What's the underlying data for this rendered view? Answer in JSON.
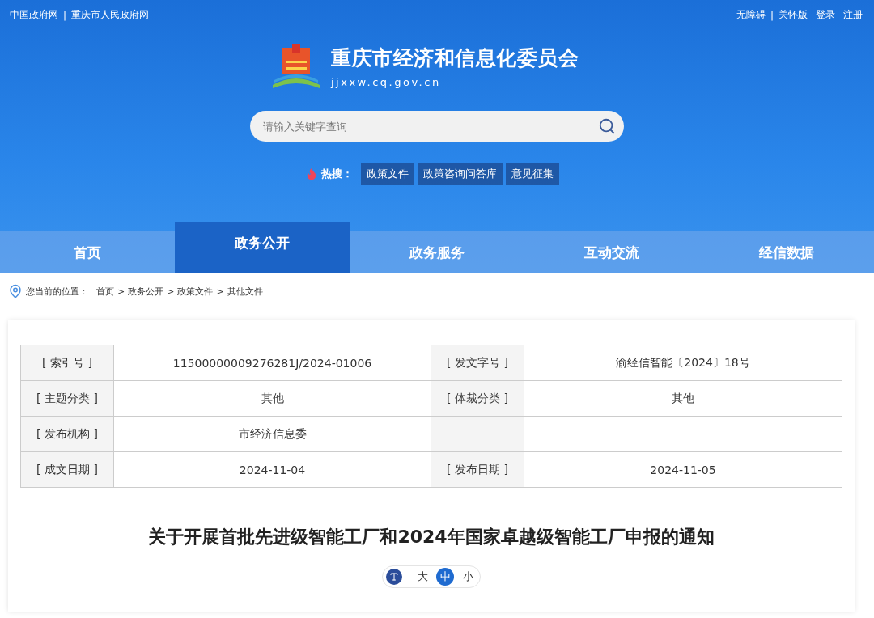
{
  "top_bar": {
    "left_links": [
      "中国政府网",
      "重庆市人民政府网"
    ],
    "left_separator": "|",
    "right_links": [
      "无障碍",
      "关怀版",
      "登录",
      "注册"
    ],
    "right_separator": "|"
  },
  "site": {
    "name": "重庆市经济和信息化委员会",
    "domain": "jjxxw.cq.gov.cn"
  },
  "search": {
    "placeholder": "请输入关键字查询"
  },
  "hot_search": {
    "label": "热搜：",
    "tags": [
      "政策文件",
      "政策咨询问答库",
      "意见征集"
    ]
  },
  "nav": [
    {
      "label": "首页",
      "selected": false
    },
    {
      "label": "政务公开",
      "selected": true
    },
    {
      "label": "政务服务",
      "selected": false
    },
    {
      "label": "互动交流",
      "selected": false
    },
    {
      "label": "经信数据",
      "selected": false
    }
  ],
  "breadcrumb": {
    "label": "您当前的位置：",
    "items": [
      "首页",
      "政务公开",
      "政策文件",
      "其他文件"
    ],
    "separator": ">"
  },
  "info_table": [
    {
      "label_1": "[ 索引号 ]",
      "value_1": "11500000009276281J/2024-01006",
      "label_2": "[ 发文字号 ]",
      "value_2": "渝经信智能〔2024〕18号"
    },
    {
      "label_1": "[ 主题分类 ]",
      "value_1": "其他",
      "label_2": "[ 体裁分类 ]",
      "value_2": "其他"
    },
    {
      "label_1": "[ 发布机构 ]",
      "value_1": "市经济信息委"
    },
    {
      "label_1": "[ 成文日期 ]",
      "value_1": "2024-11-04",
      "label_2": "[ 发布日期 ]",
      "value_2": "2024-11-05"
    }
  ],
  "article": {
    "title": "关于开展首批先进级智能工厂和2024年国家卓越级智能工厂申报的通知",
    "font_sizes": [
      {
        "label": "大",
        "selected": false
      },
      {
        "label": "中",
        "selected": true
      },
      {
        "label": "小",
        "selected": false
      }
    ]
  }
}
